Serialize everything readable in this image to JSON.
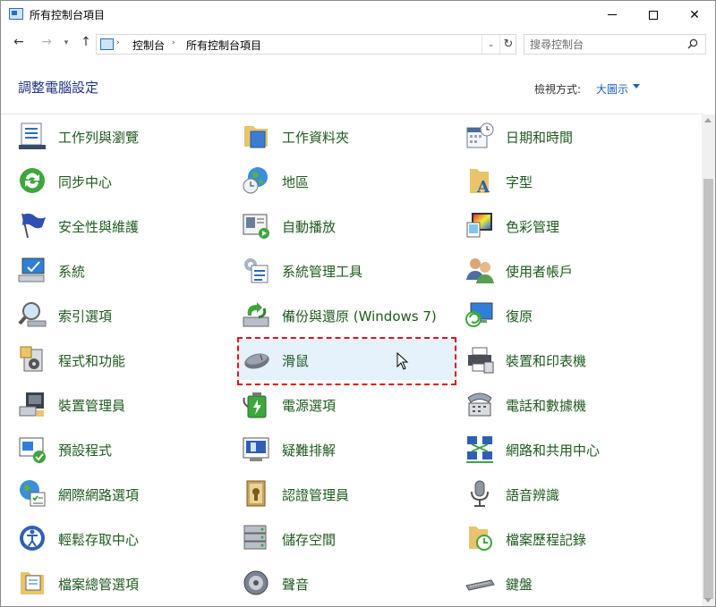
{
  "window": {
    "title": "所有控制台項目"
  },
  "address": {
    "crumbs": [
      "控制台",
      "所有控制台項目"
    ]
  },
  "search": {
    "placeholder": "搜尋控制台"
  },
  "header": {
    "title": "調整電腦設定",
    "view_label": "檢視方式:",
    "view_value": "大圖示"
  },
  "colors": {
    "title_blue": "#1e3287",
    "link_blue": "#1a5fb4",
    "item_green": "#1e5a1e",
    "highlight_bg": "#e5f1fb",
    "highlight_border": "#e0141e"
  },
  "items": [
    {
      "label": "工作列與瀏覽",
      "icon": "taskbar-icon"
    },
    {
      "label": "工作資料夾",
      "icon": "work-folders-icon"
    },
    {
      "label": "日期和時間",
      "icon": "calendar-clock-icon"
    },
    {
      "label": "同步中心",
      "icon": "sync-icon"
    },
    {
      "label": "地區",
      "icon": "globe-clock-icon"
    },
    {
      "label": "字型",
      "icon": "font-folder-icon"
    },
    {
      "label": "安全性與維護",
      "icon": "flag-icon"
    },
    {
      "label": "自動播放",
      "icon": "autoplay-icon"
    },
    {
      "label": "色彩管理",
      "icon": "color-monitor-icon"
    },
    {
      "label": "系統",
      "icon": "computer-icon"
    },
    {
      "label": "系統管理工具",
      "icon": "admin-tools-icon"
    },
    {
      "label": "使用者帳戶",
      "icon": "users-icon"
    },
    {
      "label": "索引選項",
      "icon": "magnifier-icon"
    },
    {
      "label": "備份與還原 (Windows 7)",
      "icon": "backup-icon"
    },
    {
      "label": "復原",
      "icon": "recovery-icon"
    },
    {
      "label": "程式和功能",
      "icon": "programs-icon"
    },
    {
      "label": "滑鼠",
      "icon": "mouse-icon"
    },
    {
      "label": "裝置和印表機",
      "icon": "printer-icon"
    },
    {
      "label": "裝置管理員",
      "icon": "device-manager-icon"
    },
    {
      "label": "電源選項",
      "icon": "battery-icon"
    },
    {
      "label": "電話和數據機",
      "icon": "phone-modem-icon"
    },
    {
      "label": "預設程式",
      "icon": "default-programs-icon"
    },
    {
      "label": "疑難排解",
      "icon": "troubleshoot-icon"
    },
    {
      "label": "網路和共用中心",
      "icon": "network-icon"
    },
    {
      "label": "網際網路選項",
      "icon": "internet-options-icon"
    },
    {
      "label": "認證管理員",
      "icon": "credential-icon"
    },
    {
      "label": "語音辨識",
      "icon": "microphone-icon"
    },
    {
      "label": "輕鬆存取中心",
      "icon": "ease-of-access-icon"
    },
    {
      "label": "儲存空間",
      "icon": "storage-icon"
    },
    {
      "label": "檔案歷程記錄",
      "icon": "file-history-icon"
    },
    {
      "label": "檔案總管選項",
      "icon": "folder-options-icon"
    },
    {
      "label": "聲音",
      "icon": "speaker-icon"
    },
    {
      "label": "鍵盤",
      "icon": "keyboard-icon"
    }
  ]
}
